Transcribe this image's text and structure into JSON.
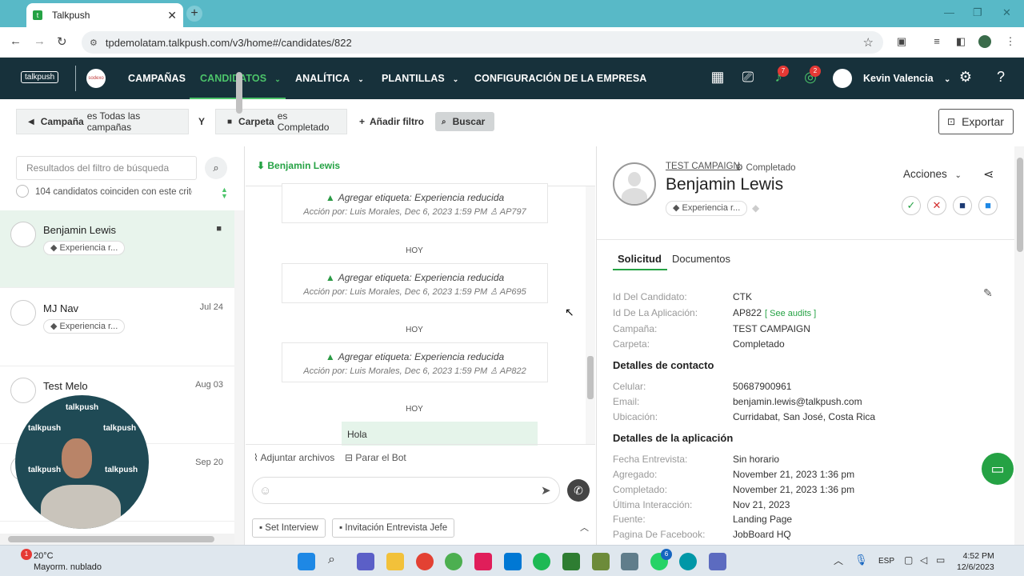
{
  "browser": {
    "tab_title": "Talkpush",
    "url": "tpdemolatam.talkpush.com/v3/home#/candidates/822"
  },
  "header": {
    "logo_text": "talkpush",
    "nav": [
      {
        "label": "CAMPAÑAS"
      },
      {
        "label": "CANDIDATOS"
      },
      {
        "label": "ANALÍTICA"
      },
      {
        "label": "PLANTILLAS"
      },
      {
        "label": "CONFIGURACIÓN DE LA EMPRESA"
      }
    ],
    "notif_badge": "7",
    "whatsapp_badge": "2",
    "user_name": "Kevin Valencia",
    "colors": {
      "bg": "#17313b",
      "accent": "#4cc46a"
    }
  },
  "filters": {
    "chip1_field": "Campaña",
    "chip1_rest": "es Todas las campañas",
    "connector": "Y",
    "chip2_field": "Carpeta",
    "chip2_rest": "es Completado",
    "add_filter": "Añadir filtro",
    "search": "Buscar",
    "export": "Exportar"
  },
  "left": {
    "search_placeholder": "Resultados del filtro de búsqueda",
    "count_text": "104 candidatos coinciden con este criterio",
    "candidates": [
      {
        "name": "Benjamin Lewis",
        "date": "",
        "tag": "Experiencia r..."
      },
      {
        "name": "MJ Nav",
        "date": "Jul 24",
        "tag": "Experiencia r..."
      },
      {
        "name": "Test Melo",
        "date": "Aug 03",
        "tag": ""
      },
      {
        "name": "",
        "date": "Sep 20",
        "tag": ""
      }
    ]
  },
  "webcam_text": "talkpush",
  "conversation": {
    "title": "Benjamin Lewis",
    "events": [
      {
        "title": "Agregar etiqueta: Experiencia reducida",
        "meta": "Acción por: Luis Morales, Dec 6, 2023 1:59 PM",
        "code": "AP797"
      },
      {
        "title": "Agregar etiqueta: Experiencia reducida",
        "meta": "Acción por: Luis Morales, Dec 6, 2023 1:59 PM",
        "code": "AP695"
      },
      {
        "title": "Agregar etiqueta: Experiencia reducida",
        "meta": "Acción por: Luis Morales, Dec 6, 2023 1:59 PM",
        "code": "AP822"
      }
    ],
    "day_label": "HOY",
    "message": "Hola",
    "attach_label": "Adjuntar archivos",
    "stop_bot_label": "Parar el Bot",
    "quick1": "Set Interview",
    "quick2": "Invitación Entrevista Jefe"
  },
  "profile": {
    "campaign": "TEST CAMPAIGN",
    "status": "Completado",
    "name": "Benjamin Lewis",
    "tag": "Experiencia r...",
    "actions_label": "Acciones",
    "tab_solicitud": "Solicitud",
    "tab_documentos": "Documentos",
    "fields": [
      {
        "label": "Id Del Candidato:",
        "value": "CTK"
      },
      {
        "label": "Id De La Aplicación:",
        "value": "AP822"
      },
      {
        "label": "Campaña:",
        "value": "TEST CAMPAIGN"
      },
      {
        "label": "Carpeta:",
        "value": "Completado"
      }
    ],
    "audits_link": "[ See audits ]",
    "contact_heading": "Detalles de contacto",
    "contact": [
      {
        "label": "Celular:",
        "value": "50687900961"
      },
      {
        "label": "Email:",
        "value": "benjamin.lewis@talkpush.com"
      },
      {
        "label": "Ubicación:",
        "value": "Curridabat, San José, Costa Rica"
      }
    ],
    "app_heading": "Detalles de la aplicación",
    "app": [
      {
        "label": "Fecha Entrevista:",
        "value": "Sin horario"
      },
      {
        "label": "Agregado:",
        "value": "November 21, 2023 1:36 pm"
      },
      {
        "label": "Completado:",
        "value": "November 21, 2023 1:36 pm"
      },
      {
        "label": "Última Interacción:",
        "value": "Nov 21, 2023"
      },
      {
        "label": "Fuente:",
        "value": "Landing Page"
      },
      {
        "label": "Pagina De Facebook:",
        "value": "JobBoard HQ"
      }
    ]
  },
  "taskbar": {
    "temp": "20°C",
    "weather": "Mayorm. nublado",
    "weather_badge": "1",
    "lang": "ESP",
    "time": "4:52 PM",
    "date": "12/6/2023",
    "whatsapp_badge": "6"
  }
}
